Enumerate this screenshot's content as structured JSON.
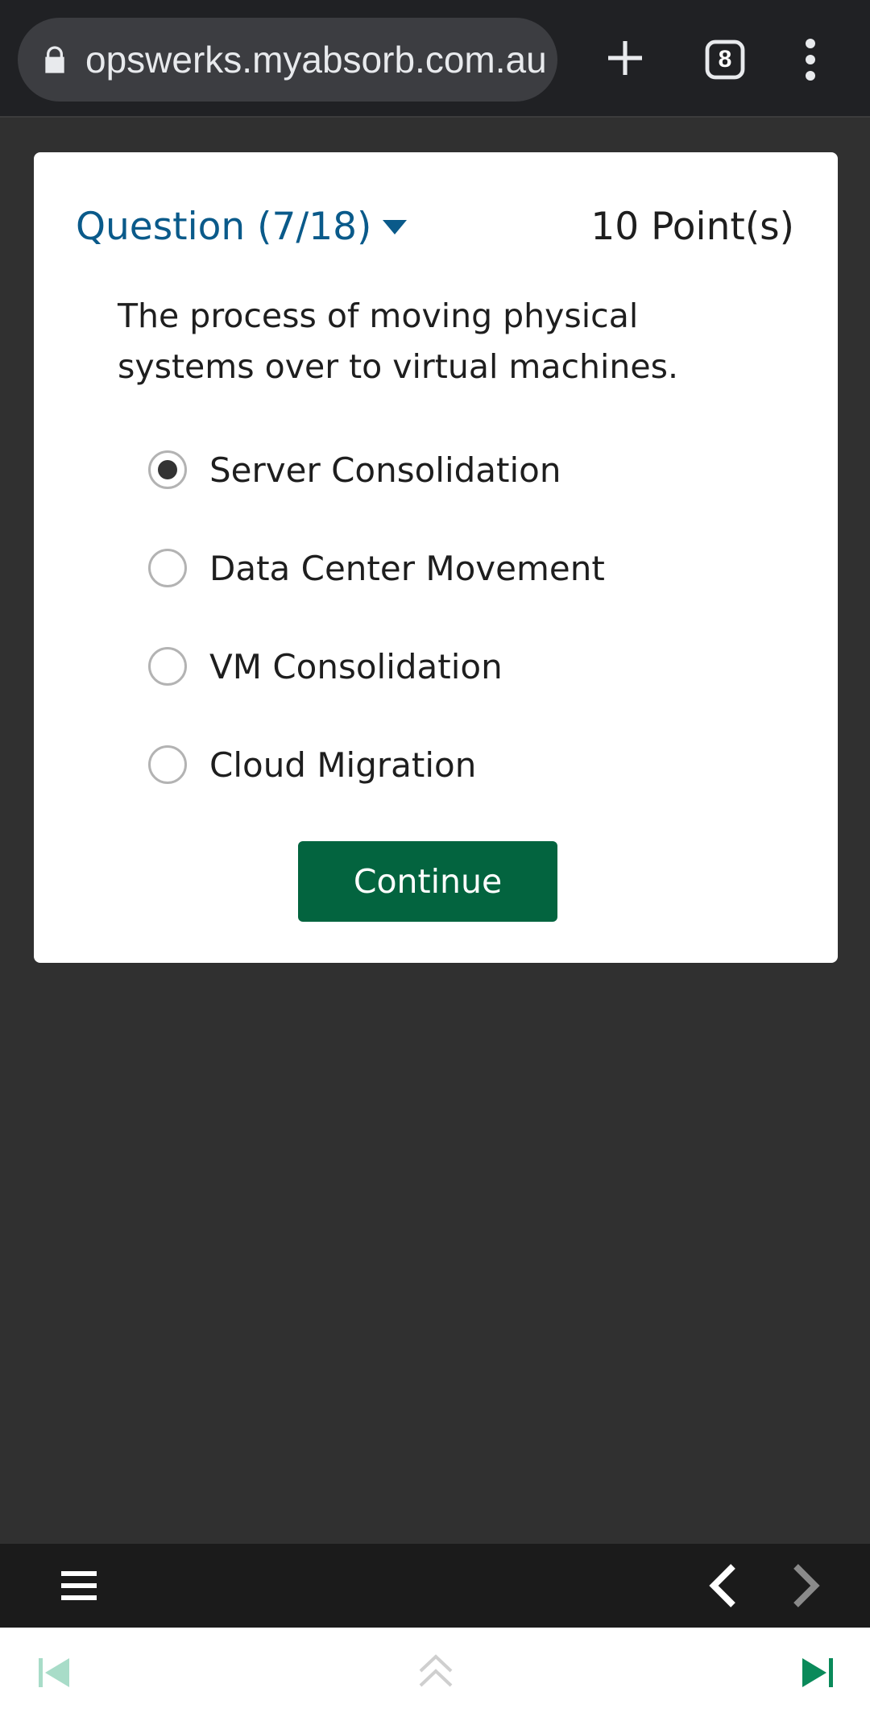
{
  "browser": {
    "url": "opswerks.myabsorb.com.au",
    "tab_count": "8",
    "icons": [
      "lock-icon",
      "plus-icon",
      "tabs-icon",
      "more-vert-icon"
    ]
  },
  "quiz": {
    "question_label": "Question (7/18)",
    "points": "10 Point(s)",
    "question_text": "The process of moving physical systems over to virtual machines.",
    "options": [
      {
        "label": "Server Consolidation",
        "selected": true
      },
      {
        "label": "Data Center Movement",
        "selected": false
      },
      {
        "label": "VM Consolidation",
        "selected": false
      },
      {
        "label": "Cloud Migration",
        "selected": false
      }
    ],
    "continue_label": "Continue"
  },
  "toolbar": {
    "icons": [
      "hamburger-icon",
      "chevron-left-icon",
      "chevron-right-icon"
    ]
  },
  "player": {
    "icons": [
      "skip-previous-icon",
      "double-chevron-up-icon",
      "skip-next-icon"
    ]
  },
  "colors": {
    "accent": "#0a5a8a",
    "button": "#03643f",
    "page_bg": "#303030",
    "player_green": "#0a8a5a",
    "player_green_faded": "#a8dcc8"
  }
}
